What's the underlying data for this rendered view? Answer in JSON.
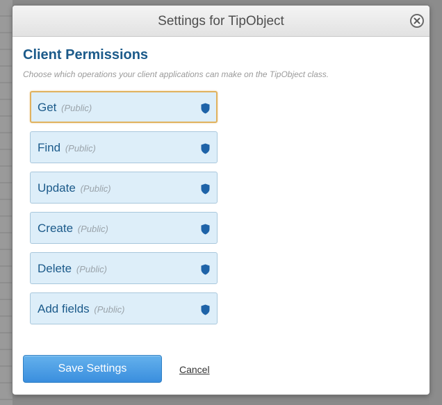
{
  "dialog": {
    "title": "Settings for TipObject",
    "close_icon": "close-circle-icon"
  },
  "section": {
    "title": "Client Permissions",
    "description": "Choose which operations your client applications can make on the TipObject class."
  },
  "permissions": [
    {
      "name": "Get",
      "access": "(Public)",
      "icon": "shield-icon",
      "focused": true
    },
    {
      "name": "Find",
      "access": "(Public)",
      "icon": "shield-icon"
    },
    {
      "name": "Update",
      "access": "(Public)",
      "icon": "shield-icon"
    },
    {
      "name": "Create",
      "access": "(Public)",
      "icon": "shield-icon"
    },
    {
      "name": "Delete",
      "access": "(Public)",
      "icon": "shield-icon"
    },
    {
      "name": "Add fields",
      "access": "(Public)",
      "icon": "shield-icon"
    }
  ],
  "footer": {
    "save_label": "Save Settings",
    "cancel_label": "Cancel"
  },
  "colors": {
    "accent_blue": "#1b5a8a",
    "item_bg": "#ddeef9",
    "focus_border": "#e0b25f",
    "save_button": "#3a8ede",
    "shield": "#1e63a8"
  }
}
